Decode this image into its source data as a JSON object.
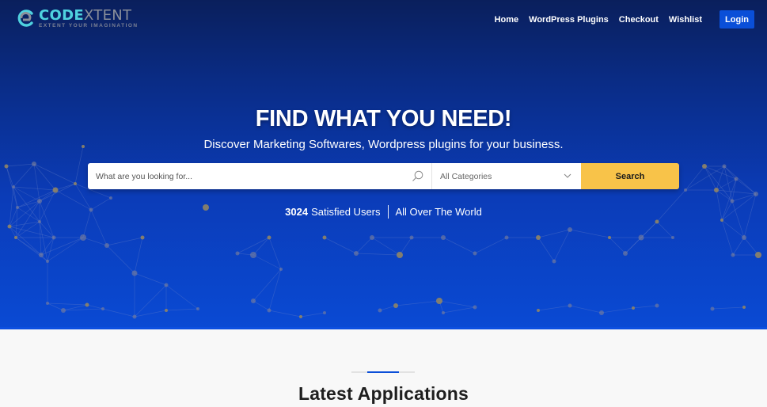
{
  "header": {
    "logo": {
      "brand_part1": "CODE",
      "brand_part2": "XTENT",
      "tagline": "EXTENT YOUR IMAGINATION"
    },
    "nav": [
      {
        "label": "Home"
      },
      {
        "label": "WordPress Plugins"
      },
      {
        "label": "Checkout"
      },
      {
        "label": "Wishlist"
      }
    ],
    "login_label": "Login"
  },
  "hero": {
    "title": "FIND WHAT YOU NEED!",
    "subtitle": "Discover Marketing Softwares, Wordpress plugins for your business.",
    "search": {
      "placeholder": "What are you looking for...",
      "value": "",
      "category_selected": "All Categories",
      "button_label": "Search"
    },
    "stats": {
      "count": "3024",
      "count_label": "Satisfied Users",
      "reach_label": "All Over The World"
    }
  },
  "section": {
    "title": "Latest Applications"
  },
  "colors": {
    "hero_top": "#0a1f5c",
    "hero_bottom": "#0a4ad4",
    "accent_blue": "#0b4fd8",
    "search_button": "#f8c349",
    "logo_teal": "#4fd2df",
    "logo_gray": "#8a8f9a"
  },
  "icons": {
    "logo": "codextent-logo-icon",
    "search": "magnifier-icon",
    "dropdown": "chevron-down-icon"
  }
}
